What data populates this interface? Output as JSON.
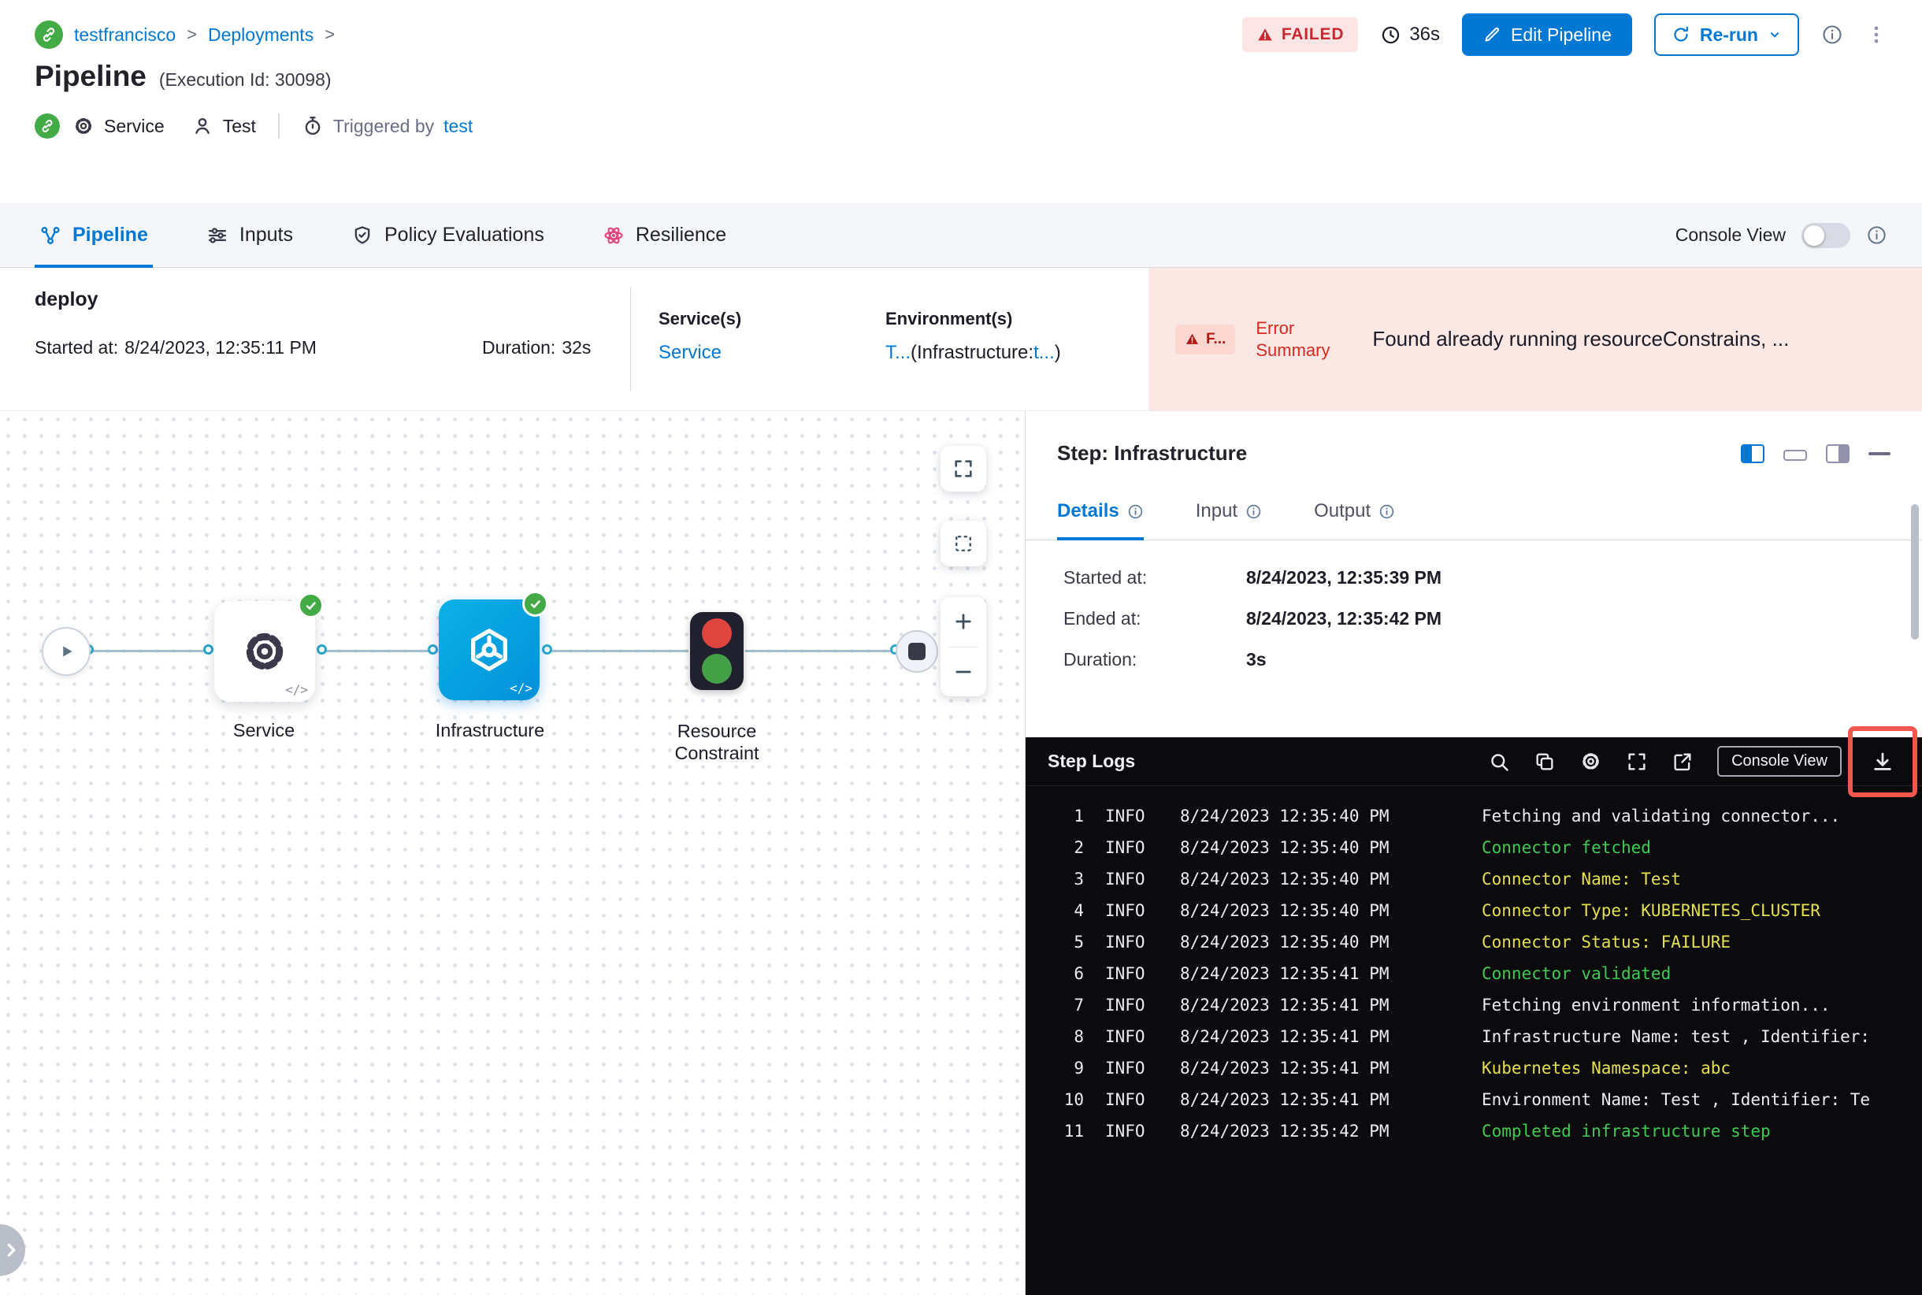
{
  "breadcrumb": {
    "project": "testfrancisco",
    "section": "Deployments",
    "separator": ">"
  },
  "header": {
    "status_badge": "FAILED",
    "elapsed": "36s",
    "edit_pipeline_label": "Edit Pipeline",
    "rerun_label": "Re-run",
    "title": "Pipeline",
    "execution_id": "(Execution Id: 30098)",
    "service_label": "Service",
    "test_label": "Test",
    "triggered_by_label": "Triggered by",
    "triggered_by_value": "test"
  },
  "tabs": [
    {
      "label": "Pipeline",
      "active": true
    },
    {
      "label": "Inputs",
      "active": false
    },
    {
      "label": "Policy Evaluations",
      "active": false
    },
    {
      "label": "Resilience",
      "active": false
    }
  ],
  "console_view_label": "Console View",
  "summary": {
    "stage_name": "deploy",
    "started_at_label": "Started at:",
    "started_at_value": "8/24/2023, 12:35:11 PM",
    "duration_label": "Duration:",
    "duration_value": "32s",
    "services_label": "Service(s)",
    "services_value": "Service",
    "environments_label": "Environment(s)",
    "env_part1": "T...",
    "env_part2": "(Infrastructure:",
    "env_part3": "t...",
    "env_part4": ")",
    "error_badge": "F...",
    "error_summary_label": "Error Summary",
    "error_summary_text": "Found already running resourceConstrains, ..."
  },
  "graph": {
    "code_mark": "</>",
    "nodes": [
      {
        "label": "Service"
      },
      {
        "label": "Infrastructure"
      },
      {
        "label": "Resource Constraint"
      }
    ]
  },
  "step_panel": {
    "title": "Step: Infrastructure",
    "tabs": [
      {
        "label": "Details"
      },
      {
        "label": "Input"
      },
      {
        "label": "Output"
      }
    ],
    "details": [
      {
        "label": "Started at:",
        "value": "8/24/2023, 12:35:39 PM"
      },
      {
        "label": "Ended at:",
        "value": "8/24/2023, 12:35:42 PM"
      },
      {
        "label": "Duration:",
        "value": "3s"
      }
    ]
  },
  "step_logs": {
    "title": "Step Logs",
    "console_view_label": "Console View",
    "lines": [
      {
        "num": 1,
        "level": "INFO",
        "time": "8/24/2023 12:35:40 PM",
        "message": "Fetching and validating connector...",
        "color": "white"
      },
      {
        "num": 2,
        "level": "INFO",
        "time": "8/24/2023 12:35:40 PM",
        "message": "Connector fetched",
        "color": "green"
      },
      {
        "num": 3,
        "level": "INFO",
        "time": "8/24/2023 12:35:40 PM",
        "message": "Connector Name: Test",
        "color": "yellow"
      },
      {
        "num": 4,
        "level": "INFO",
        "time": "8/24/2023 12:35:40 PM",
        "message": "Connector Type: KUBERNETES_CLUSTER",
        "color": "yellow"
      },
      {
        "num": 5,
        "level": "INFO",
        "time": "8/24/2023 12:35:40 PM",
        "message": "Connector Status: FAILURE",
        "color": "yellow"
      },
      {
        "num": 6,
        "level": "INFO",
        "time": "8/24/2023 12:35:41 PM",
        "message": "Connector validated",
        "color": "green"
      },
      {
        "num": 7,
        "level": "INFO",
        "time": "8/24/2023 12:35:41 PM",
        "message": "Fetching environment information...",
        "color": "white"
      },
      {
        "num": 8,
        "level": "INFO",
        "time": "8/24/2023 12:35:41 PM",
        "message": "Infrastructure Name: test , Identifier:",
        "color": "white"
      },
      {
        "num": 9,
        "level": "INFO",
        "time": "8/24/2023 12:35:41 PM",
        "message": "Kubernetes Namespace: abc",
        "color": "yellow"
      },
      {
        "num": 10,
        "level": "INFO",
        "time": "8/24/2023 12:35:41 PM",
        "message": "Environment Name: Test , Identifier: Te",
        "color": "white"
      },
      {
        "num": 11,
        "level": "INFO",
        "time": "8/24/2023 12:35:42 PM",
        "message": "Completed infrastructure step",
        "color": "green"
      }
    ]
  },
  "colors": {
    "accent_blue": "#0278d5",
    "failed_red": "#da291d",
    "error_band_pink": "#fbe7e4",
    "success_green": "#42ab45",
    "node_blue": "#0290da",
    "log_green": "#3fcb52",
    "log_yellow": "#e6df4e",
    "highlight_red": "#f4564e"
  }
}
